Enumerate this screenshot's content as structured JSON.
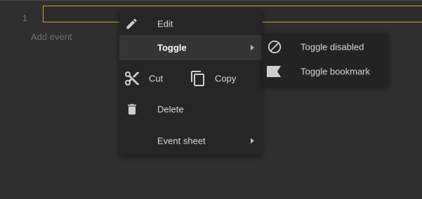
{
  "editor": {
    "line_number": "1",
    "add_event_label": "Add event"
  },
  "context_menu": {
    "edit_label": "Edit",
    "toggle_label": "Toggle",
    "cut_label": "Cut",
    "copy_label": "Copy",
    "delete_label": "Delete",
    "event_sheet_label": "Event sheet",
    "icons": {
      "edit": "pencil-icon",
      "cut": "scissors-icon",
      "copy": "copy-icon",
      "delete": "trash-icon"
    }
  },
  "toggle_submenu": {
    "toggle_disabled_label": "Toggle disabled",
    "toggle_bookmark_label": "Toggle bookmark",
    "icons": {
      "toggle_disabled": "disabled-icon",
      "toggle_bookmark": "bookmark-icon"
    }
  },
  "colors": {
    "selection_outline": "#c9a227",
    "menu_background": "#262626",
    "highlight_background": "#353535"
  }
}
